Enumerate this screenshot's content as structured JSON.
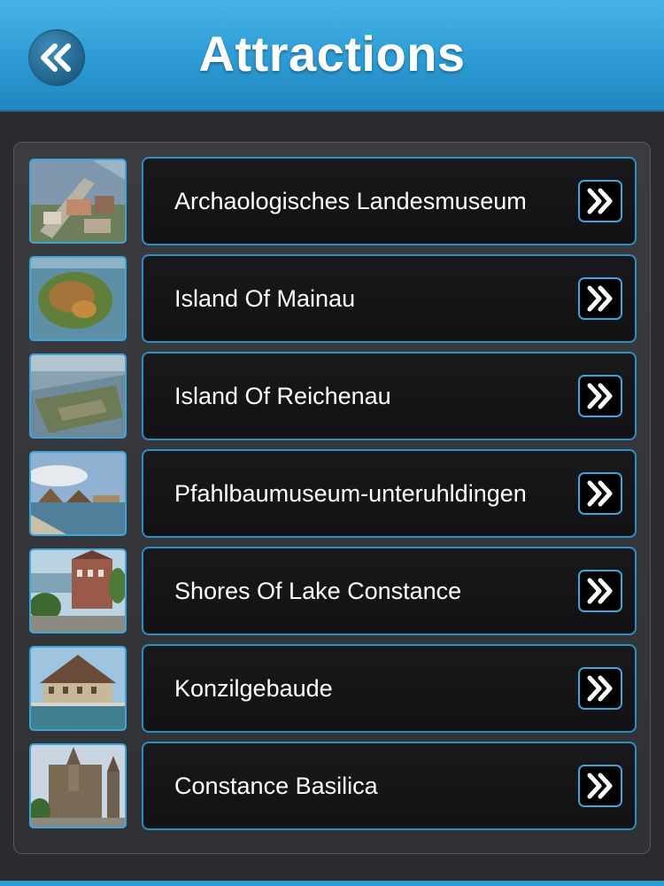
{
  "header": {
    "title": "Attractions",
    "back_icon": "double-chevron-left-icon",
    "accent_color": "#2d9bd4"
  },
  "attractions": [
    {
      "label": "Archaologisches Landesmuseum",
      "thumb": "aerial-city-photo",
      "go_icon": "double-chevron-right-icon"
    },
    {
      "label": "Island Of Mainau",
      "thumb": "island-aerial-photo",
      "go_icon": "double-chevron-right-icon"
    },
    {
      "label": "Island Of Reichenau",
      "thumb": "island-lake-photo",
      "go_icon": "double-chevron-right-icon"
    },
    {
      "label": "Pfahlbaumuseum-unteruhldingen",
      "thumb": "pile-dwellings-photo",
      "go_icon": "double-chevron-right-icon"
    },
    {
      "label": "Shores Of Lake Constance",
      "thumb": "lakeshore-town-photo",
      "go_icon": "double-chevron-right-icon"
    },
    {
      "label": "Konzilgebaude",
      "thumb": "council-building-photo",
      "go_icon": "double-chevron-right-icon"
    },
    {
      "label": "Constance Basilica",
      "thumb": "cathedral-photo",
      "go_icon": "double-chevron-right-icon"
    }
  ]
}
